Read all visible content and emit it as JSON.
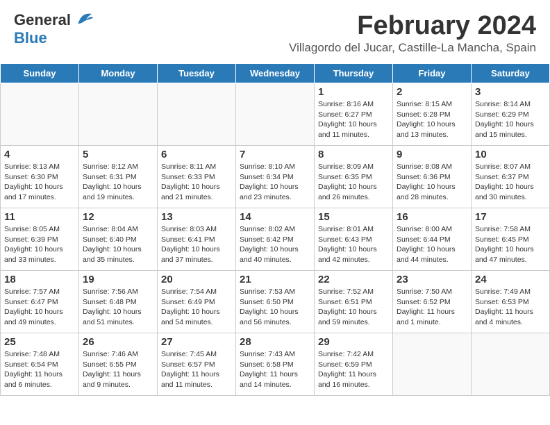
{
  "header": {
    "logo": {
      "general": "General",
      "blue": "Blue"
    },
    "title": "February 2024",
    "subtitle": "Villagordo del Jucar, Castille-La Mancha, Spain"
  },
  "days": [
    "Sunday",
    "Monday",
    "Tuesday",
    "Wednesday",
    "Thursday",
    "Friday",
    "Saturday"
  ],
  "weeks": [
    [
      {
        "date": "",
        "info": ""
      },
      {
        "date": "",
        "info": ""
      },
      {
        "date": "",
        "info": ""
      },
      {
        "date": "",
        "info": ""
      },
      {
        "date": "1",
        "info": "Sunrise: 8:16 AM\nSunset: 6:27 PM\nDaylight: 10 hours\nand 11 minutes."
      },
      {
        "date": "2",
        "info": "Sunrise: 8:15 AM\nSunset: 6:28 PM\nDaylight: 10 hours\nand 13 minutes."
      },
      {
        "date": "3",
        "info": "Sunrise: 8:14 AM\nSunset: 6:29 PM\nDaylight: 10 hours\nand 15 minutes."
      }
    ],
    [
      {
        "date": "4",
        "info": "Sunrise: 8:13 AM\nSunset: 6:30 PM\nDaylight: 10 hours\nand 17 minutes."
      },
      {
        "date": "5",
        "info": "Sunrise: 8:12 AM\nSunset: 6:31 PM\nDaylight: 10 hours\nand 19 minutes."
      },
      {
        "date": "6",
        "info": "Sunrise: 8:11 AM\nSunset: 6:33 PM\nDaylight: 10 hours\nand 21 minutes."
      },
      {
        "date": "7",
        "info": "Sunrise: 8:10 AM\nSunset: 6:34 PM\nDaylight: 10 hours\nand 23 minutes."
      },
      {
        "date": "8",
        "info": "Sunrise: 8:09 AM\nSunset: 6:35 PM\nDaylight: 10 hours\nand 26 minutes."
      },
      {
        "date": "9",
        "info": "Sunrise: 8:08 AM\nSunset: 6:36 PM\nDaylight: 10 hours\nand 28 minutes."
      },
      {
        "date": "10",
        "info": "Sunrise: 8:07 AM\nSunset: 6:37 PM\nDaylight: 10 hours\nand 30 minutes."
      }
    ],
    [
      {
        "date": "11",
        "info": "Sunrise: 8:05 AM\nSunset: 6:39 PM\nDaylight: 10 hours\nand 33 minutes."
      },
      {
        "date": "12",
        "info": "Sunrise: 8:04 AM\nSunset: 6:40 PM\nDaylight: 10 hours\nand 35 minutes."
      },
      {
        "date": "13",
        "info": "Sunrise: 8:03 AM\nSunset: 6:41 PM\nDaylight: 10 hours\nand 37 minutes."
      },
      {
        "date": "14",
        "info": "Sunrise: 8:02 AM\nSunset: 6:42 PM\nDaylight: 10 hours\nand 40 minutes."
      },
      {
        "date": "15",
        "info": "Sunrise: 8:01 AM\nSunset: 6:43 PM\nDaylight: 10 hours\nand 42 minutes."
      },
      {
        "date": "16",
        "info": "Sunrise: 8:00 AM\nSunset: 6:44 PM\nDaylight: 10 hours\nand 44 minutes."
      },
      {
        "date": "17",
        "info": "Sunrise: 7:58 AM\nSunset: 6:45 PM\nDaylight: 10 hours\nand 47 minutes."
      }
    ],
    [
      {
        "date": "18",
        "info": "Sunrise: 7:57 AM\nSunset: 6:47 PM\nDaylight: 10 hours\nand 49 minutes."
      },
      {
        "date": "19",
        "info": "Sunrise: 7:56 AM\nSunset: 6:48 PM\nDaylight: 10 hours\nand 51 minutes."
      },
      {
        "date": "20",
        "info": "Sunrise: 7:54 AM\nSunset: 6:49 PM\nDaylight: 10 hours\nand 54 minutes."
      },
      {
        "date": "21",
        "info": "Sunrise: 7:53 AM\nSunset: 6:50 PM\nDaylight: 10 hours\nand 56 minutes."
      },
      {
        "date": "22",
        "info": "Sunrise: 7:52 AM\nSunset: 6:51 PM\nDaylight: 10 hours\nand 59 minutes."
      },
      {
        "date": "23",
        "info": "Sunrise: 7:50 AM\nSunset: 6:52 PM\nDaylight: 11 hours\nand 1 minute."
      },
      {
        "date": "24",
        "info": "Sunrise: 7:49 AM\nSunset: 6:53 PM\nDaylight: 11 hours\nand 4 minutes."
      }
    ],
    [
      {
        "date": "25",
        "info": "Sunrise: 7:48 AM\nSunset: 6:54 PM\nDaylight: 11 hours\nand 6 minutes."
      },
      {
        "date": "26",
        "info": "Sunrise: 7:46 AM\nSunset: 6:55 PM\nDaylight: 11 hours\nand 9 minutes."
      },
      {
        "date": "27",
        "info": "Sunrise: 7:45 AM\nSunset: 6:57 PM\nDaylight: 11 hours\nand 11 minutes."
      },
      {
        "date": "28",
        "info": "Sunrise: 7:43 AM\nSunset: 6:58 PM\nDaylight: 11 hours\nand 14 minutes."
      },
      {
        "date": "29",
        "info": "Sunrise: 7:42 AM\nSunset: 6:59 PM\nDaylight: 11 hours\nand 16 minutes."
      },
      {
        "date": "",
        "info": ""
      },
      {
        "date": "",
        "info": ""
      }
    ]
  ]
}
